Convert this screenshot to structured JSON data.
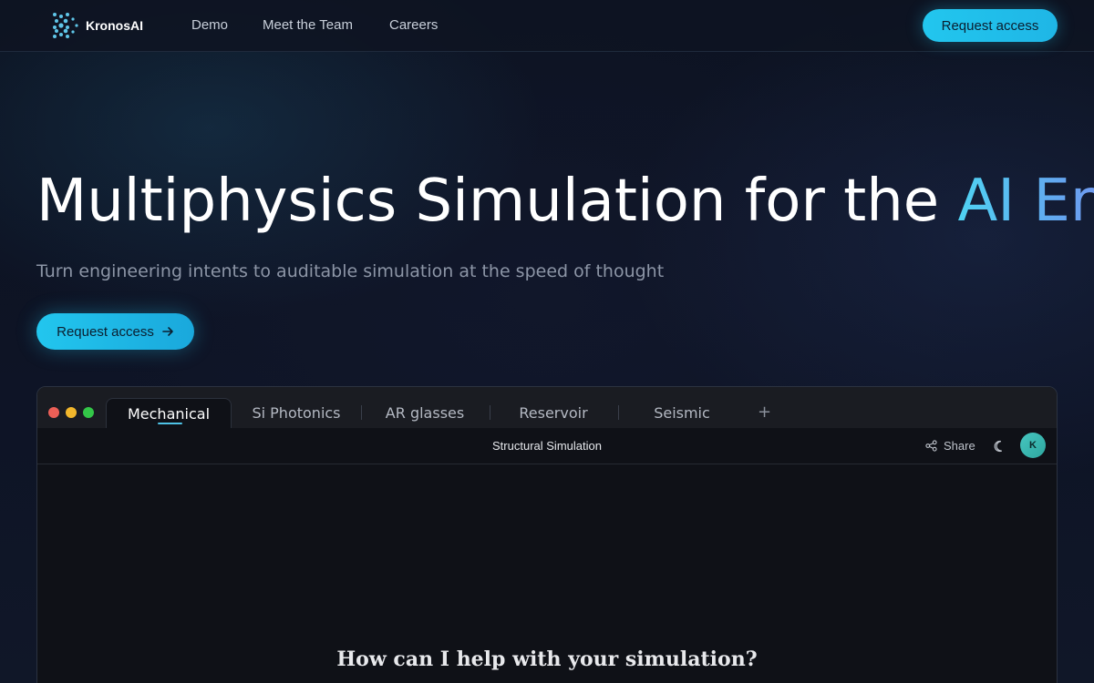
{
  "nav": {
    "brand": "KronosAI",
    "links": [
      "Demo",
      "Meet the Team",
      "Careers"
    ],
    "cta_label": "Request access"
  },
  "hero": {
    "title_main": "Multiphysics Simulation for the ",
    "title_accent": "AI Era",
    "subtitle": "Turn engineering intents to auditable simulation at the speed of thought",
    "cta_label": "Request access",
    "cta_icon": "arrow-right-icon"
  },
  "app": {
    "tabs": [
      {
        "label": "Mechanical",
        "active": true
      },
      {
        "label": "Si Photonics",
        "active": false
      },
      {
        "label": "AR glasses",
        "active": false
      },
      {
        "label": "Reservoir",
        "active": false
      },
      {
        "label": "Seismic",
        "active": false
      }
    ],
    "add_tab_label": "+",
    "toolbar_title": "Structural Simulation",
    "share_label": "Share",
    "avatar_initial": "K",
    "prompt_heading": "How can I help with your simulation?"
  },
  "colors": {
    "accent_cyan": "#22c6ee",
    "background": "#0d1220",
    "window_bg": "#0f1117"
  }
}
